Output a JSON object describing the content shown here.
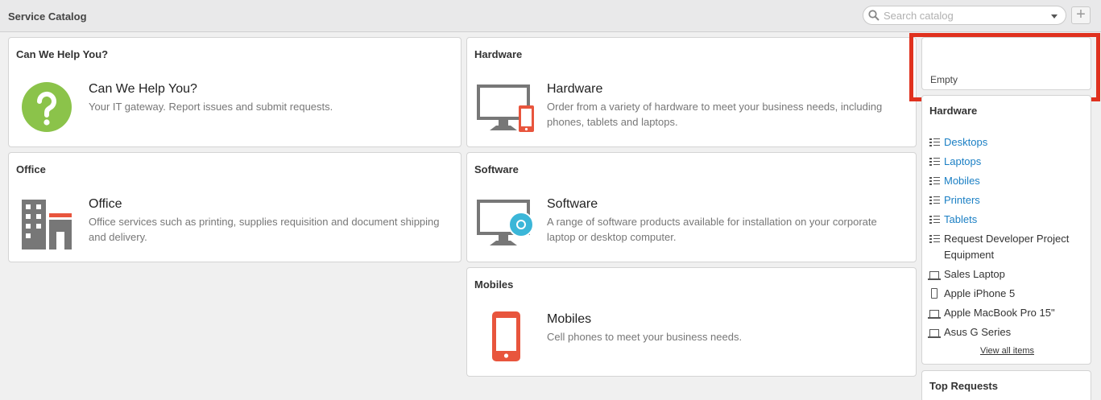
{
  "header": {
    "title": "Service Catalog"
  },
  "search": {
    "placeholder": "Search catalog",
    "add_label": "+"
  },
  "cards": {
    "help": {
      "header": "Can We Help You?",
      "name": "Can We Help You?",
      "desc": "Your IT gateway. Report issues and submit requests."
    },
    "hardware": {
      "header": "Hardware",
      "name": "Hardware",
      "desc": "Order from a variety of hardware to meet your business needs, including phones, tablets and laptops."
    },
    "office": {
      "header": "Office",
      "name": "Office",
      "desc": "Office services such as printing, supplies requisition and document shipping and delivery."
    },
    "software": {
      "header": "Software",
      "name": "Software",
      "desc": "A range of software products available for installation on your corporate laptop or desktop computer."
    },
    "mobiles": {
      "header": "Mobiles",
      "name": "Mobiles",
      "desc": "Cell phones to meet your business needs."
    }
  },
  "sidebar": {
    "empty_text": "Empty",
    "hardware": {
      "header": "Hardware",
      "items": [
        {
          "label": "Desktops",
          "icon": "list-icon",
          "link": true
        },
        {
          "label": "Laptops",
          "icon": "list-icon",
          "link": true
        },
        {
          "label": "Mobiles",
          "icon": "list-icon",
          "link": true
        },
        {
          "label": "Printers",
          "icon": "list-icon",
          "link": true
        },
        {
          "label": "Tablets",
          "icon": "list-icon",
          "link": true
        },
        {
          "label": "Request Developer Project Equipment",
          "icon": "list-icon",
          "link": false
        },
        {
          "label": "Sales Laptop",
          "icon": "laptop-icon",
          "link": false
        },
        {
          "label": "Apple iPhone 5",
          "icon": "phone-icon",
          "link": false
        },
        {
          "label": "Apple MacBook Pro 15\"",
          "icon": "laptop-icon",
          "link": false
        },
        {
          "label": "Asus G Series",
          "icon": "laptop-icon",
          "link": false
        }
      ],
      "view_all": "View all items"
    },
    "top_requests": {
      "header": "Top Requests"
    }
  },
  "colors": {
    "accent_link": "#1a7fc4",
    "highlight_red": "#e0311e",
    "help_green": "#8bc34a",
    "mobile_orange": "#e8553d",
    "software_cyan": "#3bb6d8",
    "monitor_gray": "#777777"
  }
}
